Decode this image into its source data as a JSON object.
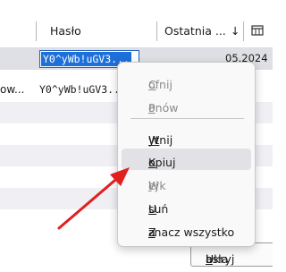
{
  "header": {
    "col_password": "Hasło",
    "col_last": "Ostatnia ...",
    "col_sort": "↓",
    "columns_icon": "table-columns-icon"
  },
  "rows": [
    {
      "password_editing": "Y0^yWb!uGV3...",
      "date": "05.2024"
    },
    {
      "site_partial": "ow...",
      "password": "Y0^yWb!uGV3..."
    }
  ],
  "context_menu": {
    "items": [
      {
        "label_prefix": "",
        "mnemonic": "C",
        "label_rest": "ofnij",
        "enabled": false
      },
      {
        "label_prefix": "",
        "mnemonic": "P",
        "label_rest": "onów",
        "enabled": false
      },
      {
        "label_prefix": "",
        "mnemonic": "W",
        "label_rest": "ytnij",
        "enabled": true
      },
      {
        "label_prefix": "",
        "mnemonic": "K",
        "label_rest": "opiuj",
        "enabled": true,
        "hovered": true
      },
      {
        "label_prefix": "Wk",
        "mnemonic": "l",
        "label_rest": "ej",
        "enabled": false
      },
      {
        "label_prefix": "",
        "mnemonic": "U",
        "label_rest": "suń",
        "enabled": true
      },
      {
        "label_prefix": "Z",
        "mnemonic": "a",
        "label_rest": "znacz wszystko",
        "enabled": true
      }
    ]
  },
  "buttons": {
    "hide_passwords_prefix": "Ukryj ",
    "hide_passwords_mnemonic": "h",
    "hide_passwords_rest": "asła"
  },
  "colors": {
    "selection": "#1e6fd9",
    "annotation_arrow": "#e02020"
  }
}
